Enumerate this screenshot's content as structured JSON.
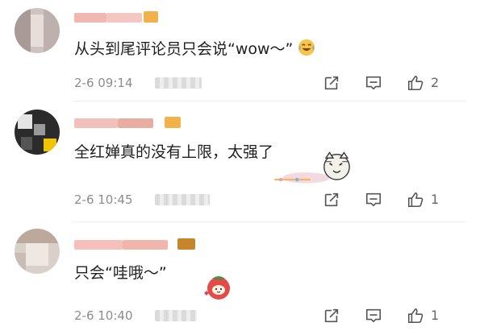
{
  "comments": [
    {
      "content": "从头到尾评论员只会说“wow～”",
      "emoji": "laughing-tears-emoji",
      "time": "2-6 09:14",
      "likes": "2"
    },
    {
      "content": "全红婵真的没有上限，太强了",
      "sticker": "cat-sticker",
      "time": "2-6 10:45",
      "likes": "1"
    },
    {
      "content": "只会“哇哦～”",
      "sticker": "strawberry-sticker",
      "time": "2-6 10:40",
      "likes": "1"
    }
  ],
  "icons": {
    "share": "share-icon",
    "comment": "comment-icon",
    "like": "thumbs-up-icon"
  },
  "colors": {
    "text": "#1f1f1f",
    "meta": "#8c8c8c",
    "icon": "#555555",
    "divider": "#ededed"
  }
}
